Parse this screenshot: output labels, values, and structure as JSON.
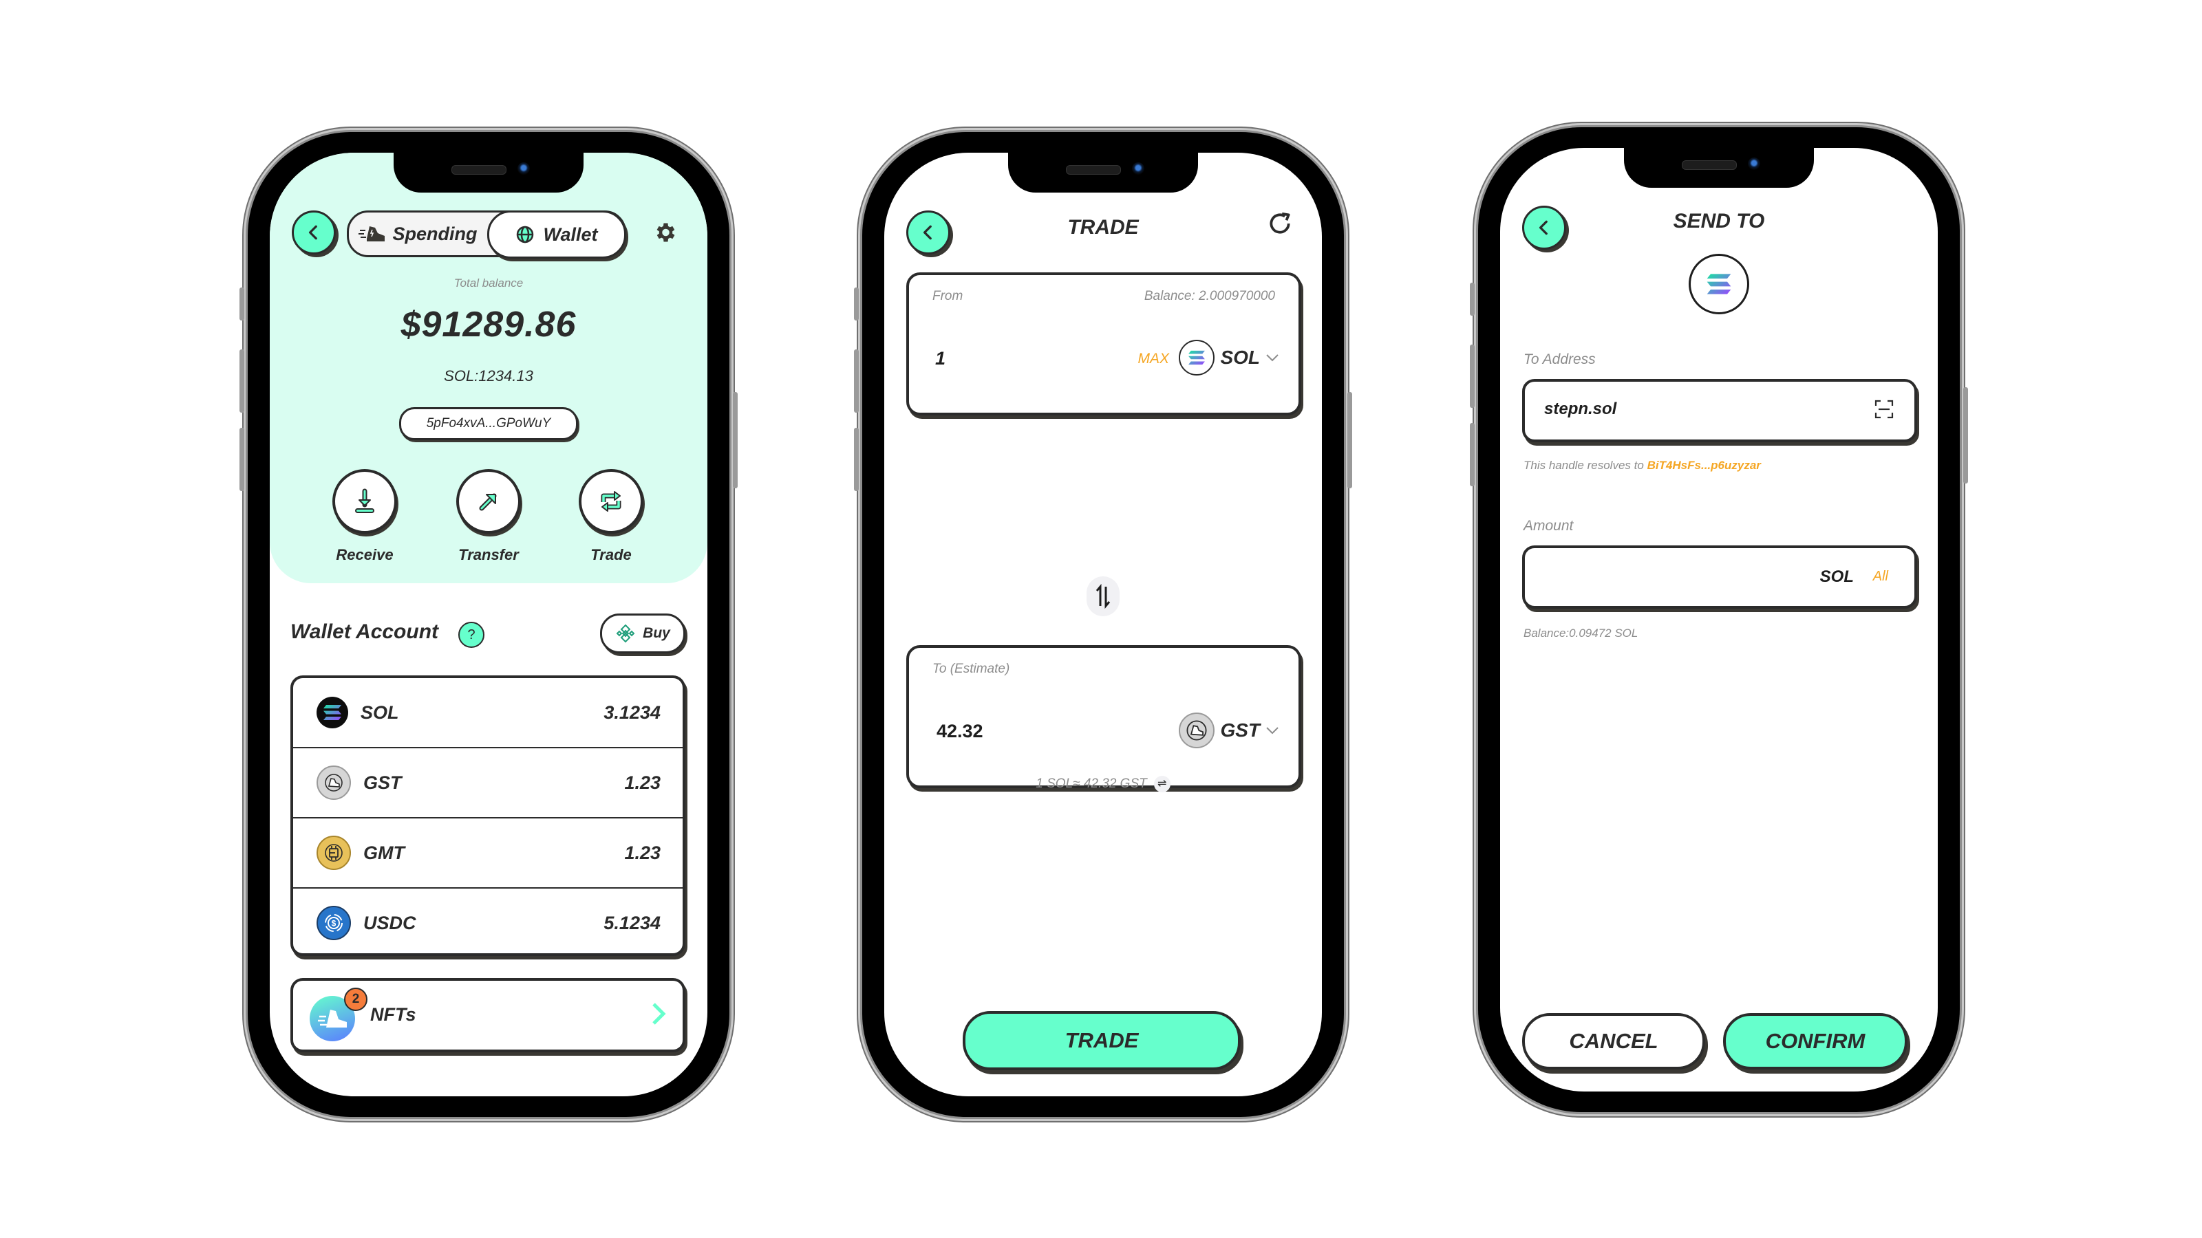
{
  "colors": {
    "accent": "#66ffcc",
    "wallet_bg": "#d9fdf1",
    "ink": "#2b2b2b",
    "highlight": "#f5a623",
    "badge": "#f57c3b"
  },
  "wallet_screen": {
    "tabs": [
      {
        "label": "Spending",
        "icon": "sneaker-icon",
        "active": false
      },
      {
        "label": "Wallet",
        "icon": "globe-icon",
        "active": true
      }
    ],
    "total_balance_label": "Total balance",
    "total_balance": "$91289.86",
    "sol_total": "SOL:1234.13",
    "address": "5pFo4xvA...GPoWuY",
    "actions": [
      {
        "label": "Receive",
        "icon": "download-icon"
      },
      {
        "label": "Transfer",
        "icon": "arrow-up-right-icon"
      },
      {
        "label": "Trade",
        "icon": "swap-cycle-icon"
      }
    ],
    "section_title": "Wallet Account",
    "help_icon": "?",
    "buy_label": "Buy",
    "tokens": [
      {
        "symbol": "SOL",
        "amount": "3.1234",
        "icon": "solana-icon"
      },
      {
        "symbol": "GST",
        "amount": "1.23",
        "icon": "gst-icon"
      },
      {
        "symbol": "GMT",
        "amount": "1.23",
        "icon": "gmt-icon"
      },
      {
        "symbol": "USDC",
        "amount": "5.1234",
        "icon": "usdc-icon"
      }
    ],
    "nfts": {
      "label": "NFTs",
      "badge_count": "2"
    }
  },
  "trade_screen": {
    "title": "TRADE",
    "from": {
      "label": "From",
      "balance": "Balance: 2.000970000",
      "amount": "1",
      "max_label": "MAX",
      "token": "SOL"
    },
    "to": {
      "label": "To (Estimate)",
      "amount": "42.32",
      "token": "GST"
    },
    "rate": "1 SOL≈ 42.32 GST",
    "rate_icon": "⇌",
    "trade_button": "TRADE"
  },
  "send_screen": {
    "title": "SEND TO",
    "to_address_label": "To Address",
    "to_address_value": "stepn.sol",
    "resolve_prefix": "This handle resolves to",
    "resolve_address": "BiT4HsFs...p6uzyzar",
    "amount_label": "Amount",
    "amount_value": "",
    "amount_unit": "SOL",
    "all_label": "All",
    "balance": "Balance:0.09472 SOL",
    "cancel_button": "CANCEL",
    "confirm_button": "CONFIRM"
  }
}
